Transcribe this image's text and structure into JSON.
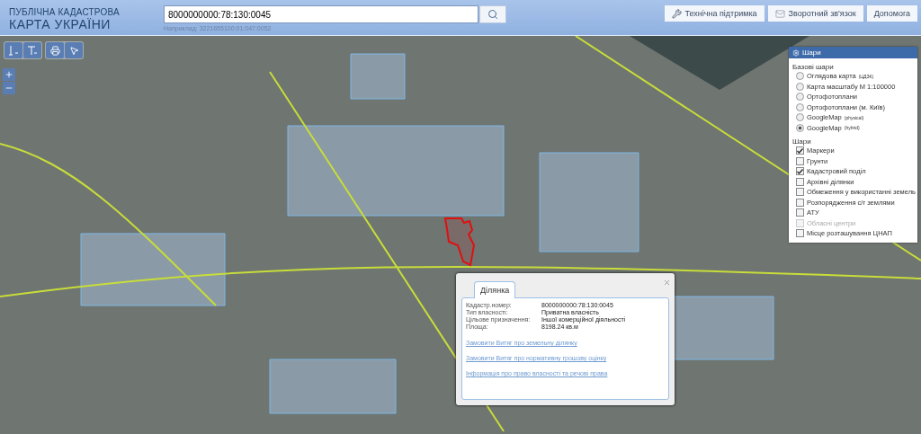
{
  "header": {
    "title_top": "ПУБЛІЧНА КАДАСТРОВА",
    "title_main": "КАРТА УКРАЇНИ",
    "search": {
      "value": "8000000000:78:130:0045",
      "hint": "Наприклад: 3221655100:01:047:0052"
    },
    "links": [
      {
        "label": "Технічна підтримка",
        "kind": "tools"
      },
      {
        "label": "Зворотний зв'язок",
        "kind": "mail"
      },
      {
        "label": "Допомога",
        "kind": "help"
      }
    ]
  },
  "layers_panel": {
    "title": "Шари",
    "base_heading": "Базові шари",
    "base_layers": [
      {
        "label": "Оглядова карта",
        "sup": "(ЦДЗК)",
        "selected": false
      },
      {
        "label": "Карта масштабу М 1:100000",
        "selected": false
      },
      {
        "label": "Ортофотоплани",
        "selected": false
      },
      {
        "label": "Ортофотоплани (м. Київ)",
        "selected": false
      },
      {
        "label": "GoogleMap",
        "sup": "(physical)",
        "selected": false
      },
      {
        "label": "GoogleMap",
        "sup": "(hybrid)",
        "selected": true
      }
    ],
    "layers_heading": "Шари",
    "layers": [
      {
        "label": "Маркери",
        "checked": true,
        "disabled": false
      },
      {
        "label": "Грунти",
        "checked": false,
        "disabled": false
      },
      {
        "label": "Кадастровий поділ",
        "checked": true,
        "disabled": false
      },
      {
        "label": "Архівні ділянки",
        "checked": false,
        "disabled": false
      },
      {
        "label": "Обмеження у використанні земель",
        "checked": false,
        "disabled": false
      },
      {
        "label": "Розпорядження с/г землями",
        "checked": false,
        "disabled": false
      },
      {
        "label": "АТУ",
        "checked": false,
        "disabled": false
      },
      {
        "label": "Обласні центри",
        "checked": false,
        "disabled": true
      },
      {
        "label": "Місце розташування ЦНАП",
        "checked": false,
        "disabled": false
      }
    ]
  },
  "popup": {
    "tab": "Ділянка",
    "fields": [
      {
        "label": "Кадастр.номер:",
        "value": "8000000000:78:130:0045"
      },
      {
        "label": "Тип власності:",
        "value": "Приватна власність"
      },
      {
        "label": "Цільове призначення:",
        "value": "Іншої комерційної діяльності"
      },
      {
        "label": "Площа:",
        "value": "8198.24 кв.м"
      }
    ],
    "links": [
      "Замовити Витяг про земельну ділянку",
      "Замовити Витяг про нормативну грошову оцінку",
      "Інформація про право власності та речові права"
    ]
  }
}
